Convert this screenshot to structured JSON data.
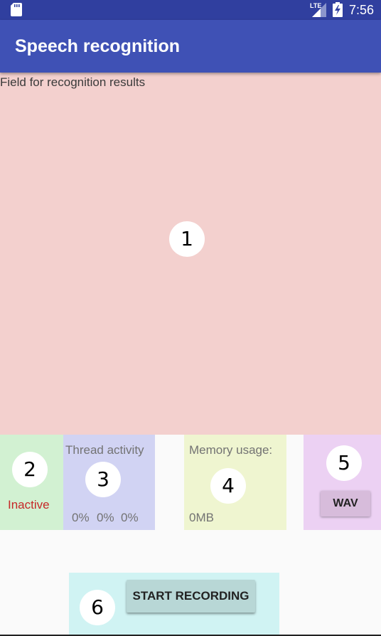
{
  "status_bar": {
    "network": "LTE",
    "time": "7:56"
  },
  "app_bar": {
    "title": "Speech recognition"
  },
  "results": {
    "placeholder": "Field for recognition results"
  },
  "status_panel": {
    "state": "Inactive"
  },
  "thread_panel": {
    "title": "Thread activity",
    "values": [
      "0%",
      "0%",
      "0%"
    ]
  },
  "memory_panel": {
    "title": "Memory usage:",
    "value": "0MB"
  },
  "wav_panel": {
    "button_label": "WAV"
  },
  "record_panel": {
    "button_label": "START RECORDING"
  },
  "markers": [
    "1",
    "2",
    "3",
    "4",
    "5",
    "6"
  ],
  "colors": {
    "status_bar": "#303f9f",
    "app_bar": "#3f51b5",
    "results_bg": "#f3d0ce",
    "status_bg": "#d2f1d2",
    "thread_bg": "#d1d3f3",
    "memory_bg": "#eff5d0",
    "wav_bg": "#ecd1f3",
    "record_bg": "#d0f3f3",
    "inactive_text": "#c62828"
  }
}
